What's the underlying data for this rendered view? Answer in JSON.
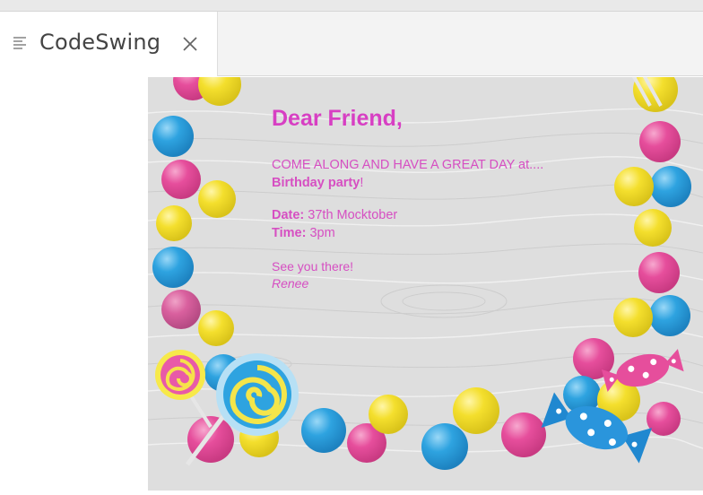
{
  "tab": {
    "title": "CodeSwing",
    "icon": "list-lines-icon",
    "close_icon": "close-icon"
  },
  "invitation": {
    "greeting": "Dear Friend,",
    "invite_line": "COME ALONG AND HAVE A GREAT DAY at....",
    "event": "Birthday party",
    "event_suffix": "!",
    "date_label": "Date:",
    "date_value": " 37th Mocktober",
    "time_label": "Time:",
    "time_value": " 3pm",
    "closing": "See you there!",
    "signature": "Renee"
  },
  "colors": {
    "text": "#d64fc2",
    "pink": "#e64e9c",
    "yellow": "#f4df2d",
    "blue": "#2ea3e0"
  }
}
